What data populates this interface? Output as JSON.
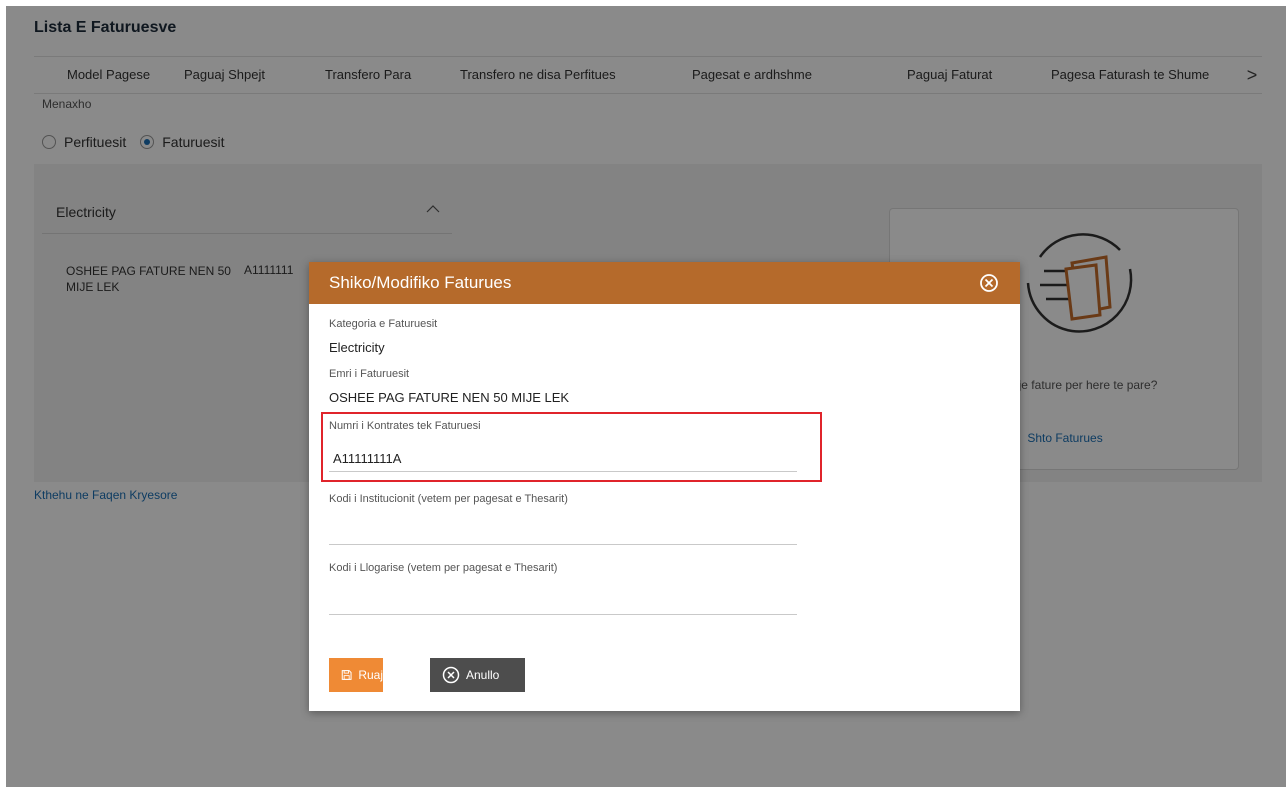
{
  "page": {
    "title": "Lista E Faturuesve",
    "tabs": [
      "Model Pagese",
      "Paguaj Shpejt",
      "Transfero Para",
      "Transfero ne disa Perfitues",
      "Pagesat e ardhshme",
      "Paguaj Faturat",
      "Pagesa Faturash te Shume"
    ],
    "tabs_arrow": ">",
    "manage_label": "Menaxho",
    "radio_options": [
      "Perfituesit",
      "Faturuesit"
    ],
    "radio_selected": "Faturuesit",
    "category": {
      "name": "Electricity",
      "biller_name": "OSHEE PAG FATURE NEN 50 MIJE LEK",
      "biller_contract": "A1111111"
    },
    "add_card": {
      "text": "aguani nje fature per here te pare?",
      "link": "Shto Faturues"
    },
    "home_link": "Kthehu ne Faqen Kryesore"
  },
  "modal": {
    "title": "Shiko/Modifiko Faturues",
    "category_label": "Kategoria e Faturuesit",
    "category_value": "Electricity",
    "biller_label": "Emri i Faturuesit",
    "biller_value": "OSHEE PAG FATURE NEN 50 MIJE LEK",
    "contract_label": "Numri i Kontrates tek Faturuesi",
    "contract_value": "A11111111A",
    "institution_label": "Kodi i Institucionit (vetem per pagesat e Thesarit)",
    "institution_value": "",
    "account_label": "Kodi i Llogarise (vetem per pagesat e Thesarit)",
    "account_value": "",
    "save_label": "Ruaj",
    "cancel_label": "Anullo"
  },
  "colors": {
    "modal_header": "#b56a2b",
    "save_button": "#ef8a35",
    "cancel_button": "#4d4d4d",
    "link": "#1a6fb5",
    "highlight": "#e0242b"
  }
}
